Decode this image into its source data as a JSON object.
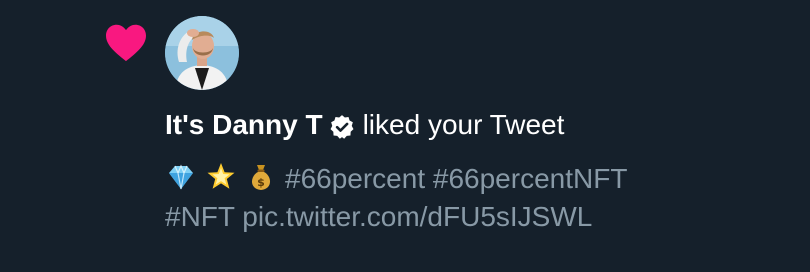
{
  "notification": {
    "type_icon": "heart-icon",
    "accent_color": "#f91880",
    "author": {
      "name": "It's Danny T",
      "verified": true,
      "verified_icon": "verified-badge-icon",
      "avatar_icon": "user-avatar"
    },
    "action_text": "liked your Tweet",
    "tweet": {
      "emojis": [
        "gem-emoji",
        "glowing-star-emoji",
        "money-bag-emoji"
      ],
      "line1_text": "#66percent #66percentNFT",
      "line2_text": "#NFT pic.twitter.com/dFU5sIJSWL"
    }
  },
  "colors": {
    "background": "#15202b",
    "primary_text": "#ffffff",
    "secondary_text": "#8899a6"
  }
}
